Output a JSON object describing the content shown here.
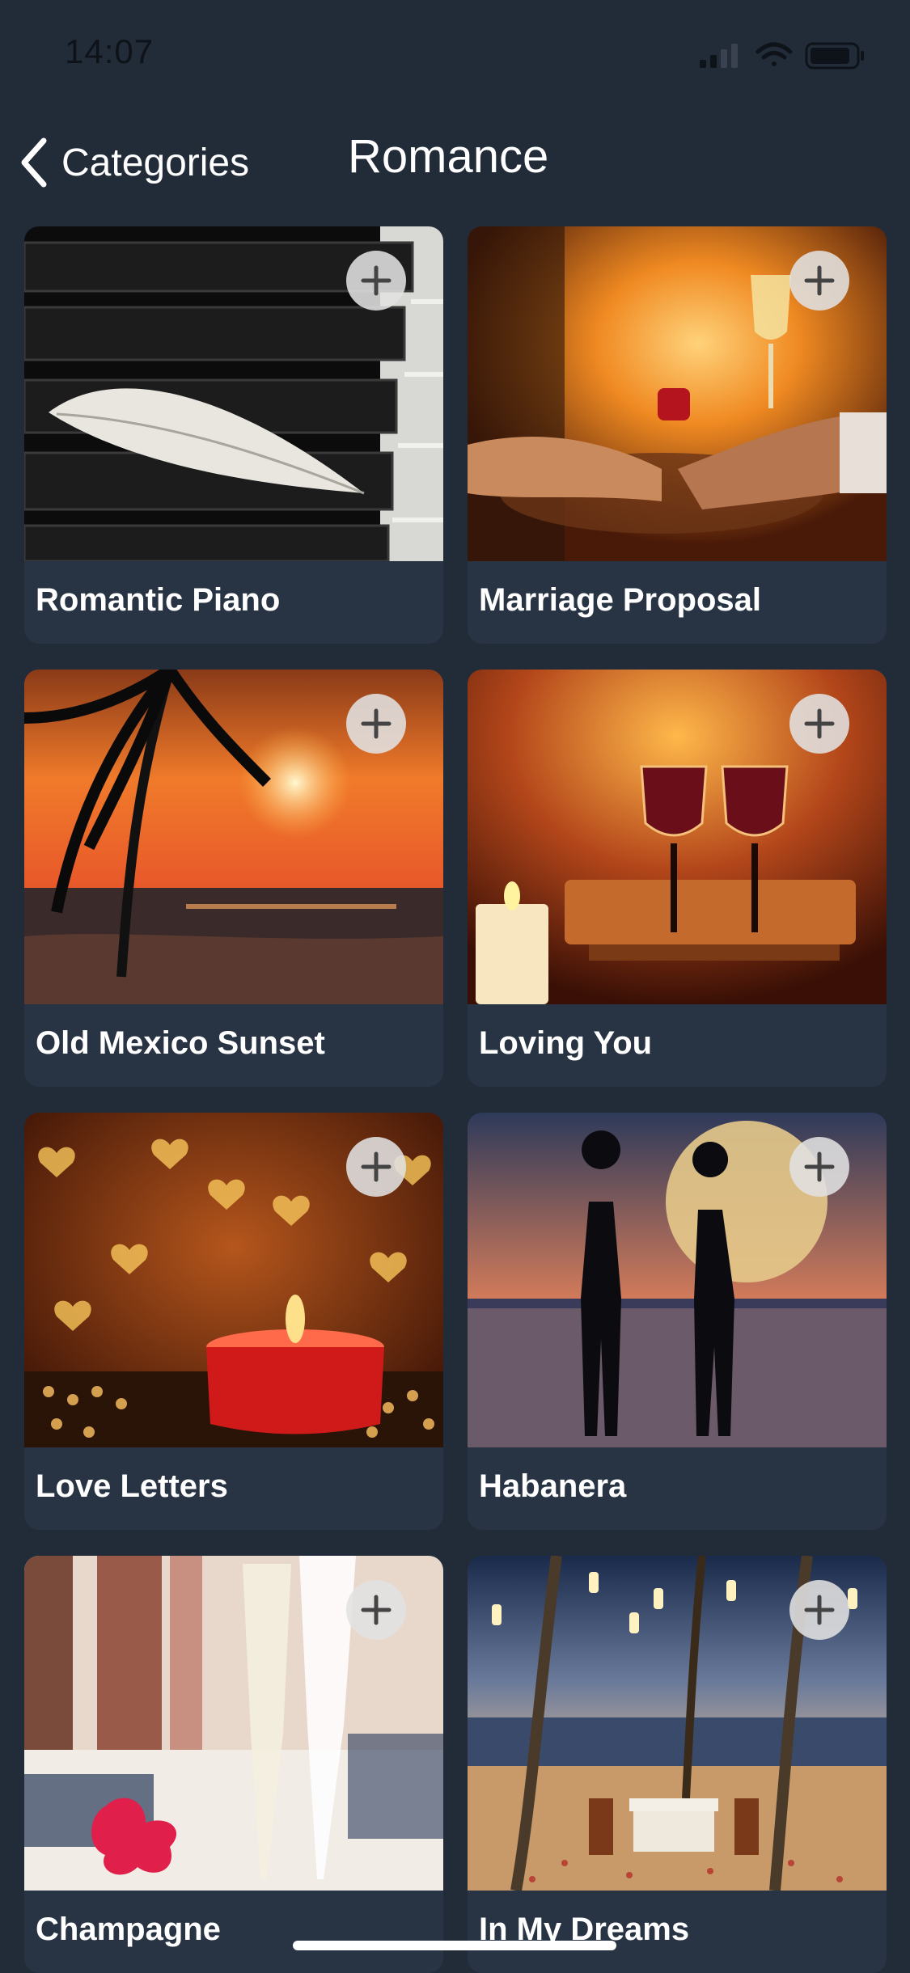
{
  "status": {
    "time": "14:07"
  },
  "nav": {
    "back_label": "Categories",
    "title": "Romance"
  },
  "cards": [
    {
      "title": "Romantic Piano"
    },
    {
      "title": "Marriage Proposal"
    },
    {
      "title": "Old Mexico Sunset"
    },
    {
      "title": "Loving You"
    },
    {
      "title": "Love Letters"
    },
    {
      "title": "Habanera"
    },
    {
      "title": "Champagne"
    },
    {
      "title": "In My Dreams"
    }
  ],
  "colors": {
    "background": "#222b38",
    "card": "#283344",
    "add_button": "#e1e1e1"
  },
  "icons": {
    "back": "chevron-left-icon",
    "add": "plus-icon"
  }
}
